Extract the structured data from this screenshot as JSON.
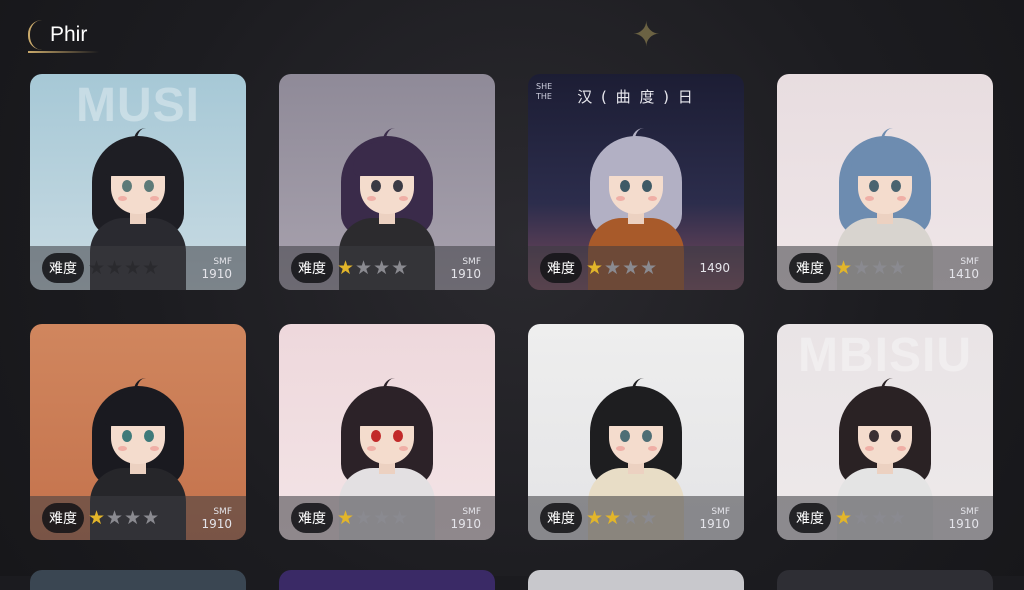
{
  "header": {
    "title": "Phir"
  },
  "difficulty_label": "难度",
  "cards": [
    {
      "watermark": "MUSI",
      "banner": "",
      "corner": [],
      "difficulty": 4,
      "meta_line1": "SMF",
      "meta_line2": "1910",
      "bg": "linear-gradient(#a6c8d6,#c9dbe3)",
      "hair": "#1e1e24",
      "outfit": "#2a2a30",
      "eyes": "#5c7a78"
    },
    {
      "watermark": "",
      "banner": "",
      "corner": [],
      "difficulty": 1,
      "meta_line1": "SMF",
      "meta_line2": "1910",
      "bg": "linear-gradient(#8f8a98,#a8a2ae)",
      "hair": "#3a2b4a",
      "outfit": "#2c2b2e",
      "eyes": "#3a3a44"
    },
    {
      "watermark": "",
      "banner": "汉 ( 曲 度 ) 日",
      "corner": [
        "SHE",
        "THE"
      ],
      "difficulty": 1,
      "meta_line1": "",
      "meta_line2": "1490",
      "bg": "linear-gradient(#1c1d34 0%,#2c2d4c 60%,#7a4a5c 100%)",
      "hair": "#b2b0c4",
      "outfit": "#a85a2a",
      "eyes": "#3e5a66"
    },
    {
      "watermark": "",
      "banner": "",
      "corner": [],
      "difficulty": 1,
      "meta_line1": "SMF",
      "meta_line2": "1410",
      "bg": "linear-gradient(#e8dde0,#efe6e8)",
      "hair": "#6d8cb0",
      "outfit": "#d8d4cf",
      "eyes": "#4a6470"
    },
    {
      "watermark": "",
      "banner": "",
      "corner": [],
      "difficulty": 1,
      "meta_line1": "SMF",
      "meta_line2": "1910",
      "bg": "linear-gradient(#d0865e,#c4724c)",
      "hair": "#1a1a20",
      "outfit": "#26262a",
      "eyes": "#3e7a7a"
    },
    {
      "watermark": "",
      "banner": "",
      "corner": [],
      "difficulty": 1,
      "meta_line1": "SMF",
      "meta_line2": "1910",
      "bg": "linear-gradient(#eed8dc,#f3e4e6)",
      "hair": "#2c2228",
      "outfit": "#e3e0e2",
      "eyes": "#c22a2a"
    },
    {
      "watermark": "",
      "banner": "",
      "corner": [],
      "difficulty": 2,
      "meta_line1": "SMF",
      "meta_line2": "1910",
      "bg": "linear-gradient(#eeeeee,#e4e4e6)",
      "hair": "#1e1e20",
      "outfit": "#e8ddc6",
      "eyes": "#4e6e75"
    },
    {
      "watermark": "MBISIU",
      "banner": "",
      "corner": [],
      "difficulty": 1,
      "meta_line1": "SMF",
      "meta_line2": "1910",
      "bg": "linear-gradient(#e9e4e6,#eee9ea)",
      "hair": "#2a2224",
      "outfit": "#e4e4e4",
      "eyes": "#3a3034"
    }
  ],
  "bottom_row_colors": [
    "#3a4652",
    "#3a2a66",
    "#c8c8cc",
    "#2e2e34"
  ],
  "colors": {
    "accent": "#c9a96b",
    "star_gold": "#e2b52a",
    "star_dark": "#2a2a2e",
    "star_grey": "#8a8a90"
  }
}
